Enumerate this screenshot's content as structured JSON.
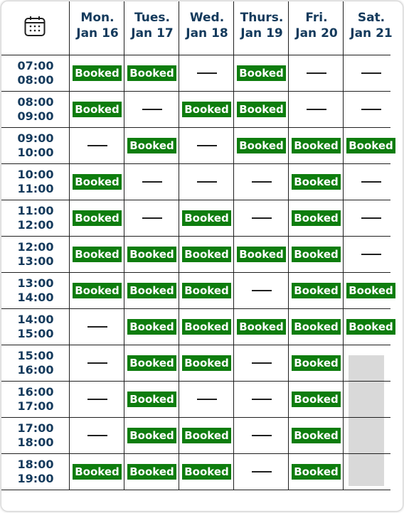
{
  "calendar": {
    "icon": "calendar-icon",
    "booked_color": "#0e7d0e",
    "days": [
      {
        "dow": "Mon.",
        "date": "Jan 16"
      },
      {
        "dow": "Tues.",
        "date": "Jan 17"
      },
      {
        "dow": "Wed.",
        "date": "Jan 18"
      },
      {
        "dow": "Thurs.",
        "date": "Jan 19"
      },
      {
        "dow": "Fri.",
        "date": "Jan 20"
      },
      {
        "dow": "Sat.",
        "date": "Jan 21"
      }
    ],
    "slots": [
      {
        "start": "07:00",
        "end": "08:00"
      },
      {
        "start": "08:00",
        "end": "09:00"
      },
      {
        "start": "09:00",
        "end": "10:00"
      },
      {
        "start": "10:00",
        "end": "11:00"
      },
      {
        "start": "11:00",
        "end": "12:00"
      },
      {
        "start": "12:00",
        "end": "13:00"
      },
      {
        "start": "13:00",
        "end": "14:00"
      },
      {
        "start": "14:00",
        "end": "15:00"
      },
      {
        "start": "15:00",
        "end": "16:00"
      },
      {
        "start": "16:00",
        "end": "17:00"
      },
      {
        "start": "17:00",
        "end": "18:00"
      },
      {
        "start": "18:00",
        "end": "19:00"
      }
    ],
    "booked_label": "Booked",
    "grid": [
      [
        "Booked",
        "Booked",
        "—",
        "Booked",
        "—",
        "—"
      ],
      [
        "Booked",
        "—",
        "Booked",
        "Booked",
        "—",
        "—"
      ],
      [
        "—",
        "Booked",
        "—",
        "Booked",
        "Booked",
        "Booked"
      ],
      [
        "Booked",
        "—",
        "—",
        "—",
        "Booked",
        "—"
      ],
      [
        "Booked",
        "—",
        "Booked",
        "—",
        "Booked",
        "—"
      ],
      [
        "Booked",
        "Booked",
        "Booked",
        "Booked",
        "Booked",
        "—"
      ],
      [
        "Booked",
        "Booked",
        "Booked",
        "—",
        "Booked",
        "Booked"
      ],
      [
        "—",
        "Booked",
        "Booked",
        "Booked",
        "Booked",
        "Booked"
      ],
      [
        "—",
        "Booked",
        "Booked",
        "—",
        "Booked",
        ""
      ],
      [
        "—",
        "Booked",
        "—",
        "—",
        "Booked",
        ""
      ],
      [
        "—",
        "Booked",
        "Booked",
        "—",
        "Booked",
        ""
      ],
      [
        "Booked",
        "Booked",
        "Booked",
        "—",
        "Booked",
        ""
      ]
    ]
  }
}
